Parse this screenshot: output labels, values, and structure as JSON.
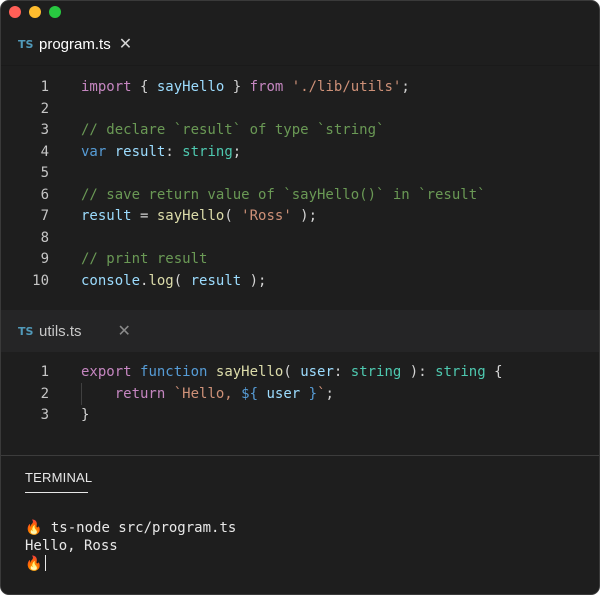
{
  "tabs": {
    "program": {
      "badge": "TS",
      "name": "program.ts",
      "close": "✕"
    },
    "utils": {
      "badge": "TS",
      "name": "utils.ts",
      "close": "✕"
    }
  },
  "program_lines": [
    {
      "n": "1",
      "parts": [
        [
          "kw-pink",
          "import"
        ],
        [
          "punc",
          " { "
        ],
        [
          "var",
          "sayHello"
        ],
        [
          "punc",
          " } "
        ],
        [
          "kw-pink",
          "from"
        ],
        [
          "punc",
          " "
        ],
        [
          "str",
          "'./lib/utils'"
        ],
        [
          "punc",
          ";"
        ]
      ]
    },
    {
      "n": "2",
      "parts": []
    },
    {
      "n": "3",
      "parts": [
        [
          "cmt",
          "// declare `result` of type `string`"
        ]
      ]
    },
    {
      "n": "4",
      "parts": [
        [
          "kw-blue",
          "var"
        ],
        [
          "punc",
          " "
        ],
        [
          "var",
          "result"
        ],
        [
          "punc",
          ": "
        ],
        [
          "type",
          "string"
        ],
        [
          "punc",
          ";"
        ]
      ]
    },
    {
      "n": "5",
      "parts": []
    },
    {
      "n": "6",
      "parts": [
        [
          "cmt",
          "// save return value of `sayHello()` in `result`"
        ]
      ]
    },
    {
      "n": "7",
      "parts": [
        [
          "var",
          "result"
        ],
        [
          "punc",
          " = "
        ],
        [
          "fn",
          "sayHello"
        ],
        [
          "punc",
          "( "
        ],
        [
          "str",
          "'Ross'"
        ],
        [
          "punc",
          " );"
        ]
      ]
    },
    {
      "n": "8",
      "parts": []
    },
    {
      "n": "9",
      "parts": [
        [
          "cmt",
          "// print result"
        ]
      ]
    },
    {
      "n": "10",
      "parts": [
        [
          "var",
          "console"
        ],
        [
          "punc",
          "."
        ],
        [
          "fn",
          "log"
        ],
        [
          "punc",
          "( "
        ],
        [
          "var",
          "result"
        ],
        [
          "punc",
          " );"
        ]
      ]
    }
  ],
  "utils_lines": [
    {
      "n": "1",
      "parts": [
        [
          "kw-pink",
          "export"
        ],
        [
          "punc",
          " "
        ],
        [
          "kw-blue",
          "function"
        ],
        [
          "punc",
          " "
        ],
        [
          "fn",
          "sayHello"
        ],
        [
          "punc",
          "( "
        ],
        [
          "var",
          "user"
        ],
        [
          "punc",
          ": "
        ],
        [
          "type",
          "string"
        ],
        [
          "punc",
          " ): "
        ],
        [
          "type",
          "string"
        ],
        [
          "punc",
          " {"
        ]
      ]
    },
    {
      "n": "2",
      "parts": [
        [
          "punc",
          "    "
        ],
        [
          "kw-pink",
          "return"
        ],
        [
          "punc",
          " "
        ],
        [
          "str",
          "`Hello, "
        ],
        [
          "kw-blue",
          "${"
        ],
        [
          "punc",
          " "
        ],
        [
          "var",
          "user"
        ],
        [
          "punc",
          " "
        ],
        [
          "kw-blue",
          "}"
        ],
        [
          "str",
          "`"
        ],
        [
          "punc",
          ";"
        ]
      ]
    },
    {
      "n": "3",
      "parts": [
        [
          "punc",
          "}"
        ]
      ]
    }
  ],
  "terminal": {
    "tab_label": "TERMINAL",
    "prompt_icon": "🔥",
    "command": " ts-node src/program.ts",
    "output": "Hello, Ross"
  },
  "colors": {
    "editor_bg": "#1e1e1e",
    "keyword": "#c586c0",
    "storage": "#569cd6",
    "function": "#dcdcaa",
    "variable": "#9cdcfe",
    "type": "#4ec9b0",
    "string": "#ce9178",
    "comment": "#6a9955"
  }
}
